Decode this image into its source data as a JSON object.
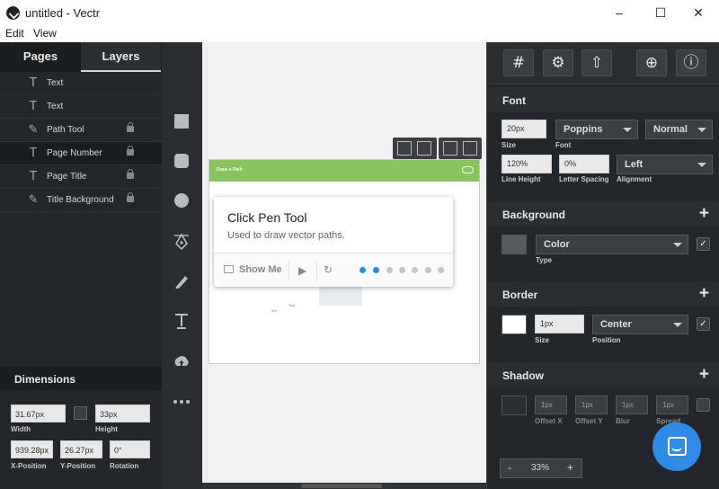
{
  "window": {
    "title": "untitled - Vectr",
    "minimize_symbol": "‒",
    "maximize_symbol": "☐",
    "close_symbol": "✕"
  },
  "menu": [
    "Edit",
    "View"
  ],
  "left_panel": {
    "tabs": [
      "Pages",
      "Layers"
    ],
    "layers": [
      {
        "icon": "text-icon",
        "name": "Text",
        "locked": false
      },
      {
        "icon": "text-icon",
        "name": "Text",
        "locked": false
      },
      {
        "icon": "pen-tool-icon",
        "name": "Path Tool",
        "locked": true
      },
      {
        "icon": "text-icon",
        "name": "Page Number",
        "locked": true
      },
      {
        "icon": "text-icon",
        "name": "Page Title",
        "locked": true
      },
      {
        "icon": "pen-tool-icon",
        "name": "Title Background",
        "locked": true
      }
    ],
    "dimensions": {
      "title": "Dimensions",
      "width": {
        "label": "Width",
        "value": "31.67px"
      },
      "height": {
        "label": "Height",
        "value": "33px"
      },
      "x": {
        "label": "X-Position",
        "value": "939.28px"
      },
      "y": {
        "label": "Y-Position",
        "value": "26.27px"
      },
      "rotation": {
        "label": "Rotation",
        "value": "0°"
      }
    }
  },
  "tools": [
    "rectangle-tool-icon",
    "rounded-rectangle-tool-icon",
    "ellipse-tool-icon",
    "pen-tool-icon",
    "pencil-tool-icon",
    "text-tool-icon",
    "upload-tool-icon",
    "more-tools-icon"
  ],
  "canvas": {
    "banner_text": "Draw a Path",
    "tiny_text_1": "Text",
    "tiny_text_2": "Text"
  },
  "popup": {
    "title": "Click Pen Tool",
    "subtitle": "Used to draw vector paths.",
    "show_me": "Show Me",
    "step_count": 7,
    "active_step": 2
  },
  "right_panel": {
    "font": {
      "title": "Font",
      "size": {
        "label": "Size",
        "value": "20px"
      },
      "family": {
        "label": "Font",
        "value": "Poppins"
      },
      "weight": "Normal",
      "line_height": {
        "label": "Line Height",
        "value": "120%"
      },
      "letter_spacing": {
        "label": "Letter Spacing",
        "value": "0%"
      },
      "alignment": {
        "label": "Alignment",
        "value": "Left"
      }
    },
    "background": {
      "title": "Background",
      "type": {
        "label": "Type",
        "value": "Color"
      },
      "swatch": "#555a5e",
      "checked": true
    },
    "border": {
      "title": "Border",
      "size": {
        "label": "Size",
        "value": "1px"
      },
      "position": {
        "label": "Position",
        "value": "Center"
      },
      "swatch": "#ffffff",
      "checked": true
    },
    "shadow": {
      "title": "Shadow",
      "offset_x": {
        "label": "Offset X",
        "value": "1px"
      },
      "offset_y": {
        "label": "Offset Y",
        "value": "1px"
      },
      "blur": {
        "label": "Blur",
        "value": "1px"
      },
      "spread": {
        "label": "Spread",
        "value": "1px"
      },
      "swatch": "#2a2e32",
      "checked": false
    },
    "zoom": {
      "minus": "-",
      "value": "33%",
      "plus": "+"
    }
  },
  "colors": {
    "accent": "#2d8ed7",
    "banner": "#8ac45f",
    "chat": "#2f8be6"
  }
}
